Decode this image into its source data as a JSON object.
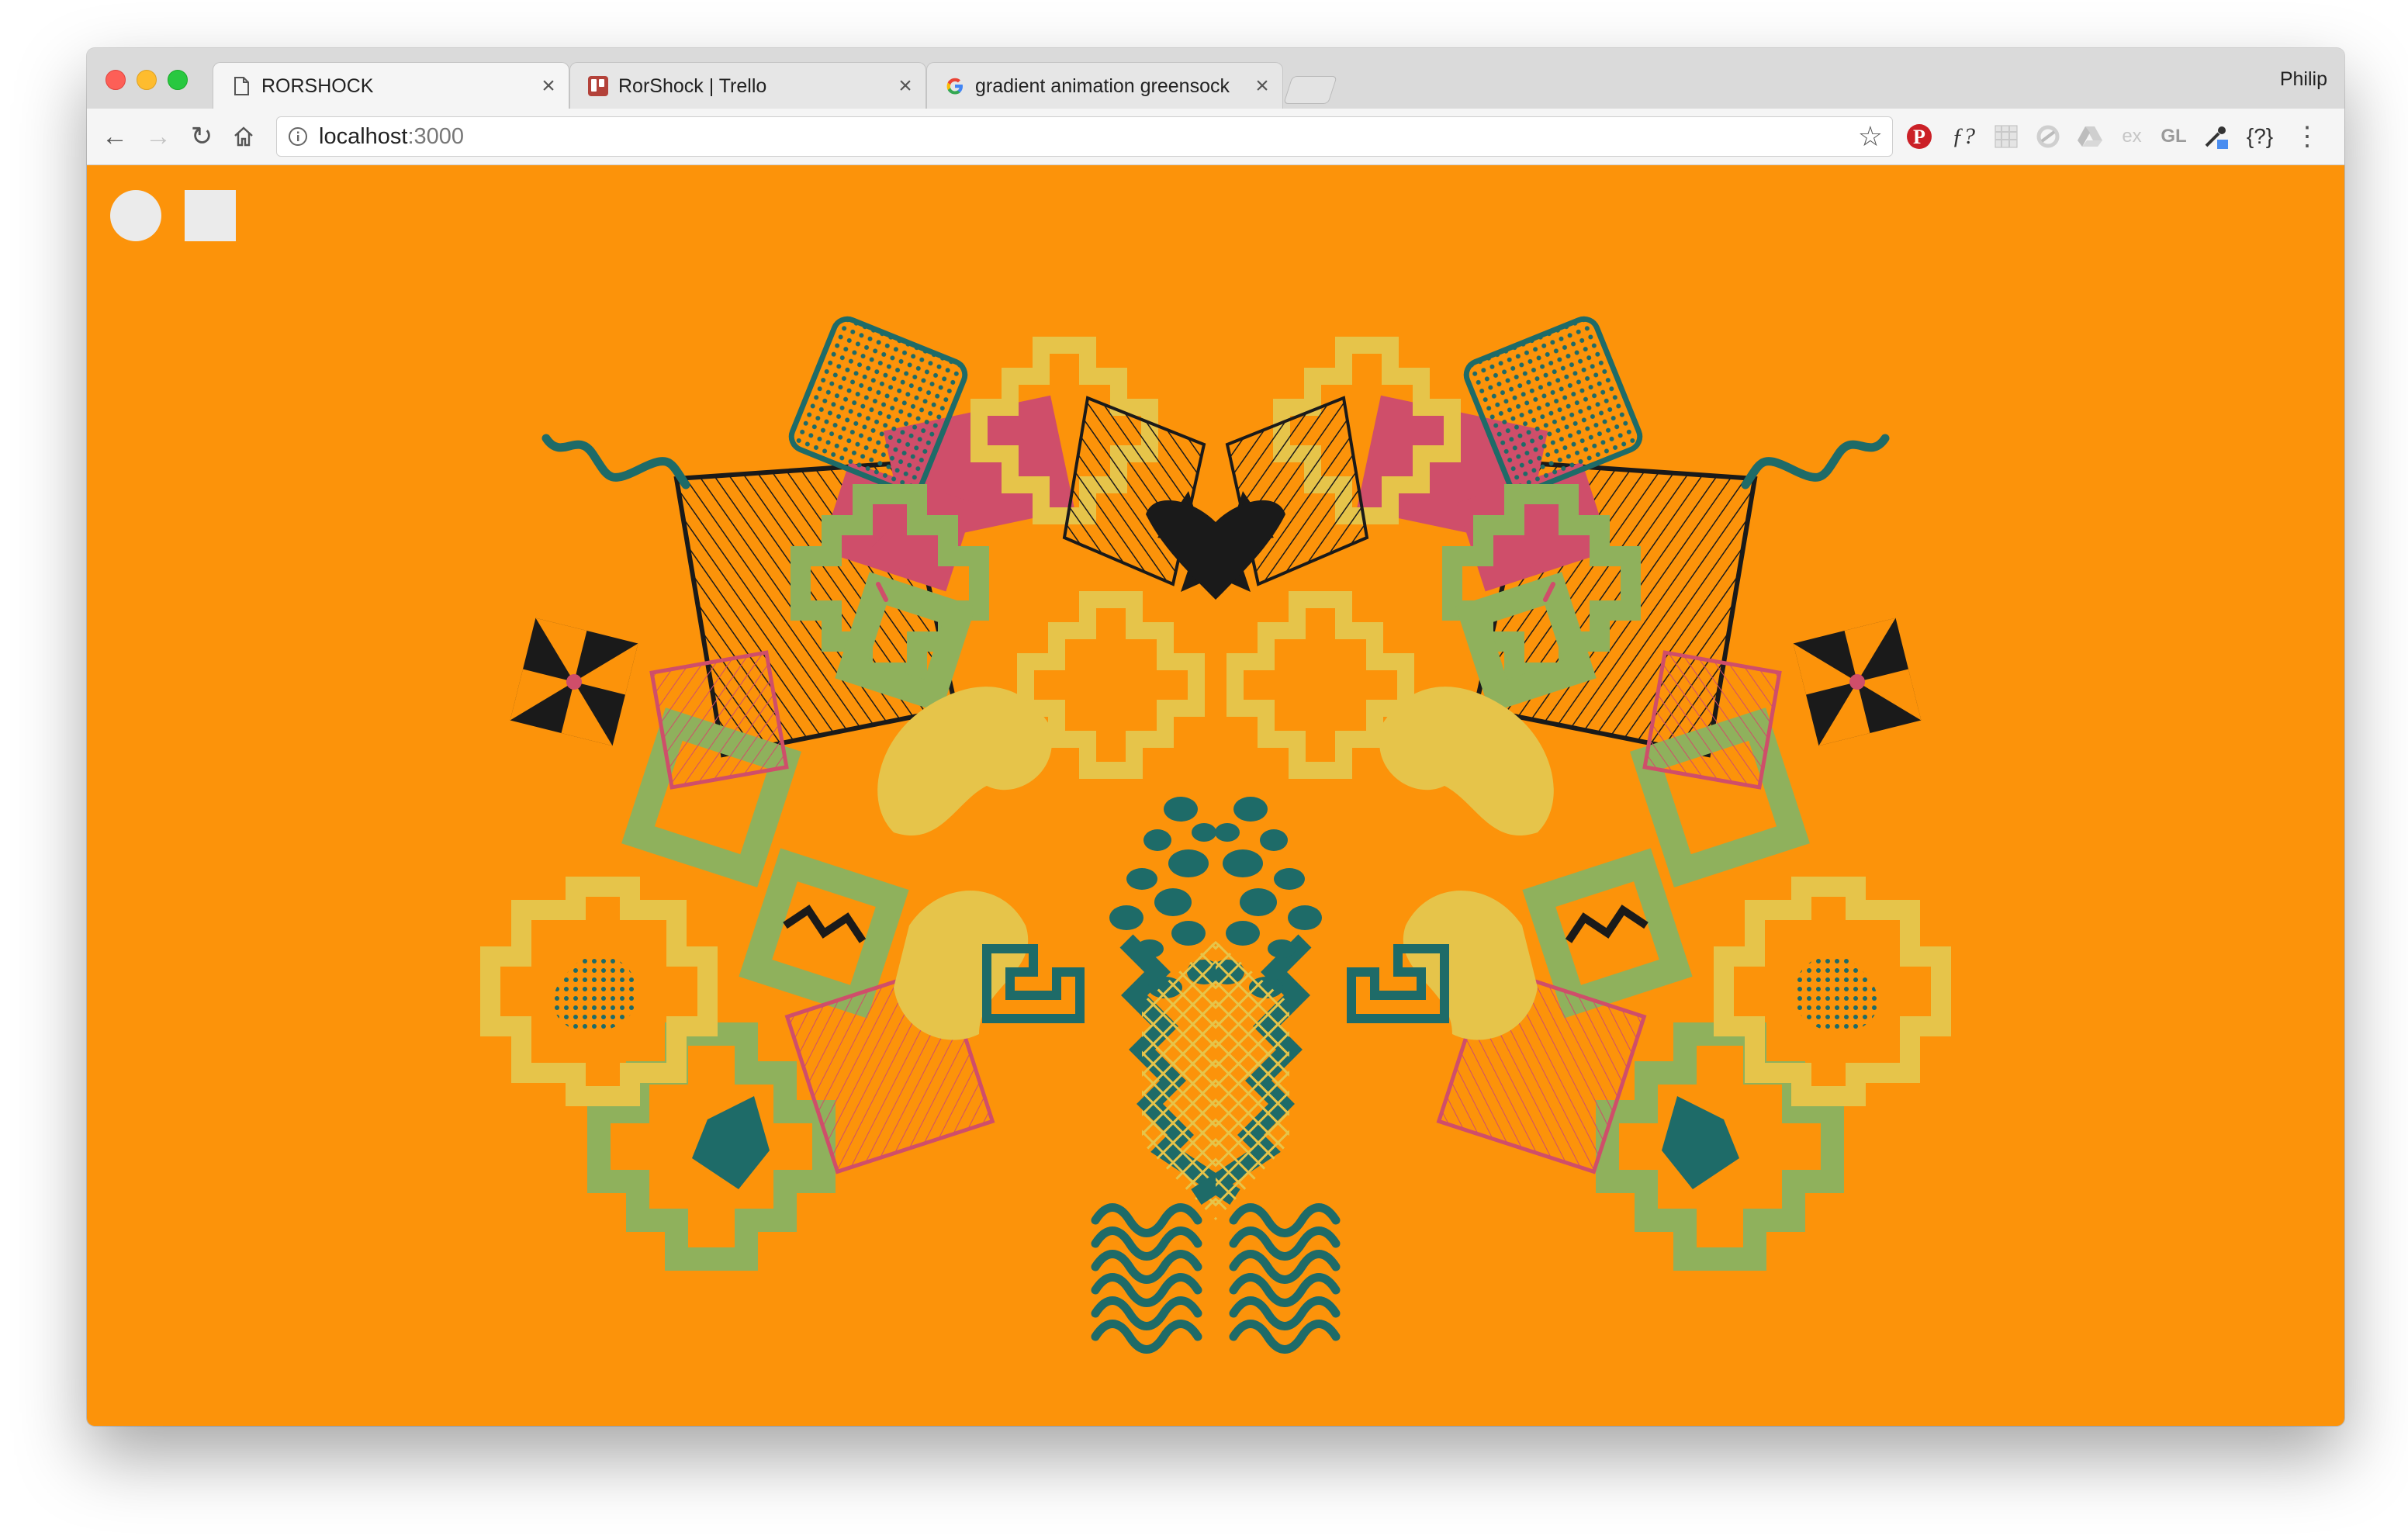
{
  "browser": {
    "tabs": [
      {
        "title": "RORSHOCK",
        "favicon": "document-icon",
        "active": true
      },
      {
        "title": "RorShock | Trello",
        "favicon": "trello-icon",
        "active": false
      },
      {
        "title": "gradient animation greensock",
        "favicon": "google-icon",
        "active": false
      }
    ],
    "profile_name": "Philip",
    "url_host": "localhost",
    "url_port": ":3000",
    "extensions": {
      "pinterest": "P",
      "formula": "ƒ?",
      "ex": "ex",
      "gl": "GL",
      "braces": "{?}"
    }
  },
  "page": {
    "background_color": "#fc930a",
    "palette": [
      "#1e6b68",
      "#e6c44a",
      "#8fb15c",
      "#cf4e6a",
      "#1a1a1a"
    ],
    "controls": [
      {
        "shape": "circle",
        "icon": "circle-icon"
      },
      {
        "shape": "square",
        "icon": "square-icon"
      }
    ]
  }
}
